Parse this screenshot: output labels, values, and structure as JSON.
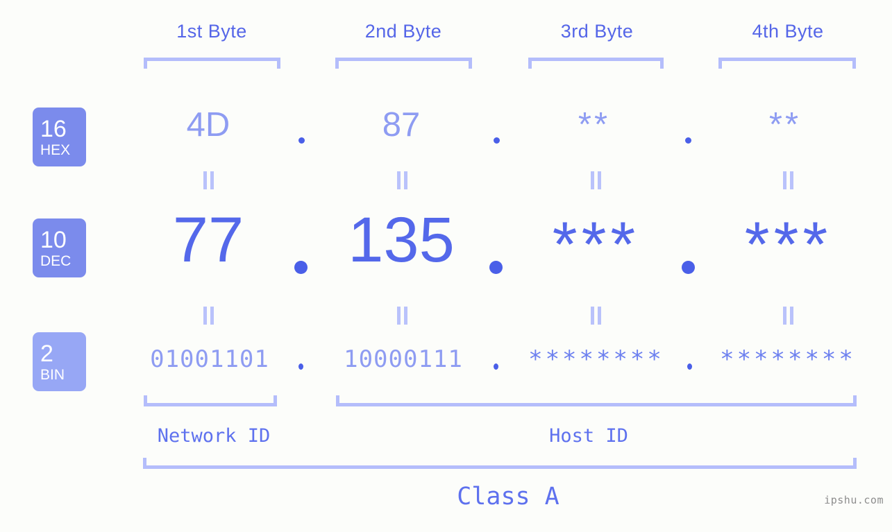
{
  "meta": {
    "background_color": "#fcfdfa",
    "accent_color": "#5468ea",
    "light_accent_color": "#8e9cf2",
    "bracket_color": "#b4bdfb",
    "badge_color": "#7b8bec",
    "badge_color_light": "#97a7f5"
  },
  "byte_headers": [
    {
      "label": "1st Byte"
    },
    {
      "label": "2nd Byte"
    },
    {
      "label": "3rd Byte"
    },
    {
      "label": "4th Byte"
    }
  ],
  "radix_badges": [
    {
      "number": "16",
      "abbr": "HEX"
    },
    {
      "number": "10",
      "abbr": "DEC"
    },
    {
      "number": "2",
      "abbr": "BIN"
    }
  ],
  "rows": {
    "hex": {
      "values": [
        "4D",
        "87",
        "**",
        "**"
      ]
    },
    "dec": {
      "values": [
        "77",
        "135",
        "***",
        "***"
      ]
    },
    "bin": {
      "values": [
        "01001101",
        "10000111",
        "********",
        "********"
      ]
    }
  },
  "separators": {
    "hex": [
      ".",
      ".",
      "."
    ],
    "dec": [
      ".",
      ".",
      "."
    ],
    "bin": [
      ".",
      ".",
      "."
    ]
  },
  "connectors": {
    "symbol": "=",
    "count_per_gap": 4
  },
  "id_sections": [
    {
      "label": "Network ID"
    },
    {
      "label": "Host ID"
    }
  ],
  "class_label": "Class A",
  "watermark": "ipshu.com"
}
